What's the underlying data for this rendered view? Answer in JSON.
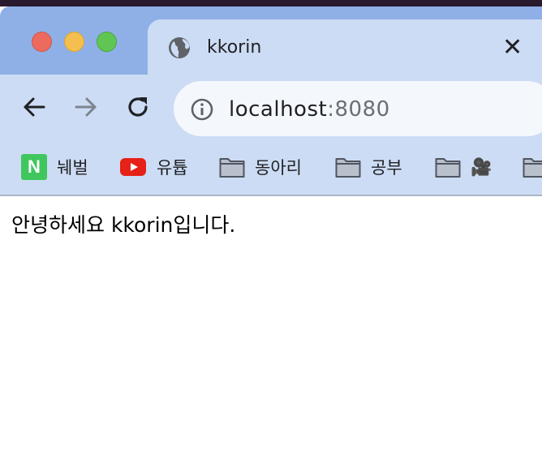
{
  "tab": {
    "title": "kkorin",
    "close_label": "✕"
  },
  "address": {
    "host": "localhost",
    "port": ":8080"
  },
  "bookmarks": [
    {
      "label": "눼벌",
      "icon": "naver-icon"
    },
    {
      "label": "유튭",
      "icon": "youtube-icon"
    },
    {
      "label": "동아리",
      "icon": "folder-icon"
    },
    {
      "label": "공부",
      "icon": "folder-icon"
    },
    {
      "label": "🎥",
      "icon": "folder-icon"
    },
    {
      "label": "",
      "icon": "folder-icon"
    }
  ],
  "page": {
    "text": "안녕하세요 kkorin입니다."
  },
  "colors": {
    "titlebar": "#8fb0e6",
    "toolbar": "#ccdcf4",
    "omnibox": "#f4f7fc",
    "naver": "#3fc75d",
    "youtube": "#e62117"
  }
}
